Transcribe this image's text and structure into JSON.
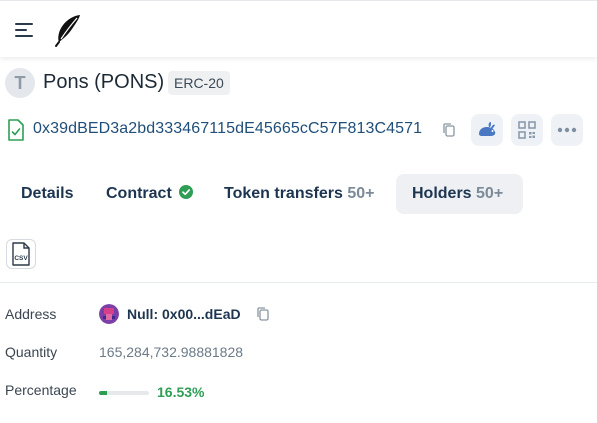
{
  "header": {
    "menu_icon": "hamburger-menu-icon",
    "logo_icon": "feather-quill-icon"
  },
  "token": {
    "avatar_letter": "T",
    "title": "Pons (PONS)",
    "standard": "ERC-20",
    "address": "0x39dBED3a2bd333467115dE45665cC57F813C4571"
  },
  "actions": {
    "copy": "copy-icon",
    "rabbit": "rabbit-icon",
    "qr": "qr-code-icon",
    "more": "more-icon"
  },
  "tabs": [
    {
      "label": "Details",
      "count": ""
    },
    {
      "label": "Contract",
      "count": ""
    },
    {
      "label": "Token transfers",
      "count": "50+"
    },
    {
      "label": "Holders",
      "count": "50+"
    }
  ],
  "csv_label": "CSV",
  "holder": {
    "address_label": "Address",
    "address_name": "Null: 0x00...dEaD",
    "quantity_label": "Quantity",
    "quantity": "165,284,732.98881828",
    "percentage_label": "Percentage",
    "percentage": "16.53%",
    "percentage_value": 16.53
  },
  "colors": {
    "accent_green": "#2e9e55",
    "link_blue": "#1f4e79"
  }
}
